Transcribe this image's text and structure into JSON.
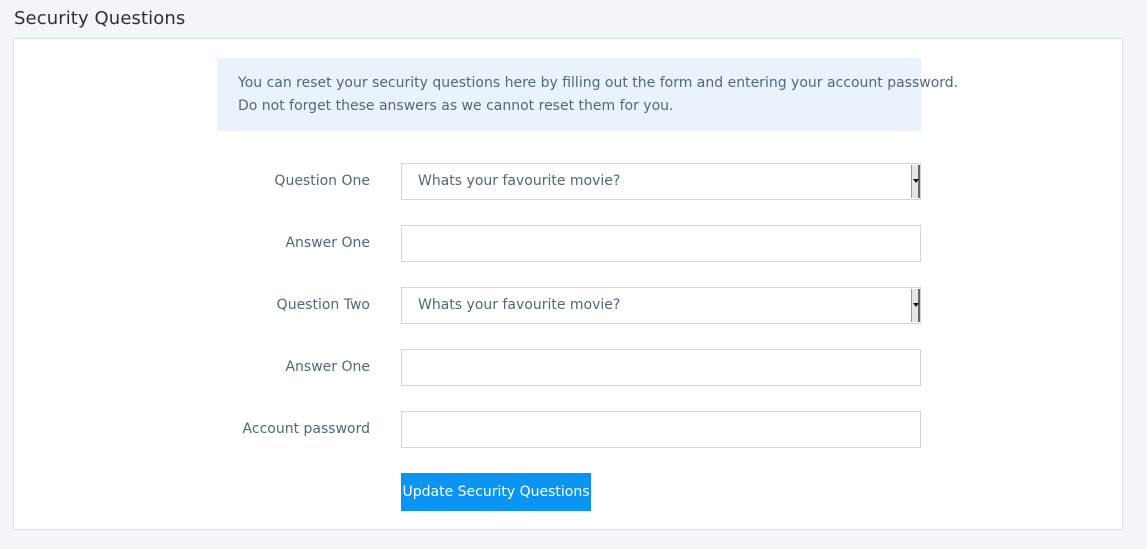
{
  "page": {
    "title": "Security Questions"
  },
  "info": {
    "line1": "You can reset your security questions here by filling out the form and entering your account password.",
    "line2": "Do not forget these answers as we cannot reset them for you."
  },
  "form": {
    "question_one": {
      "label": "Question One",
      "selected": "Whats your favourite movie?"
    },
    "answer_one": {
      "label": "Answer One",
      "value": ""
    },
    "question_two": {
      "label": "Question Two",
      "selected": "Whats your favourite movie?"
    },
    "answer_two": {
      "label": "Answer One",
      "value": ""
    },
    "password": {
      "label": "Account password",
      "value": ""
    },
    "submit_label": "Update Security Questions"
  },
  "colors": {
    "accent": "#0b95f2",
    "info_background": "#eaf3fb",
    "page_background": "#f3f6f7",
    "text": "#54667a"
  },
  "icons": {
    "select_arrow": "dropdown-arrow-icon"
  }
}
